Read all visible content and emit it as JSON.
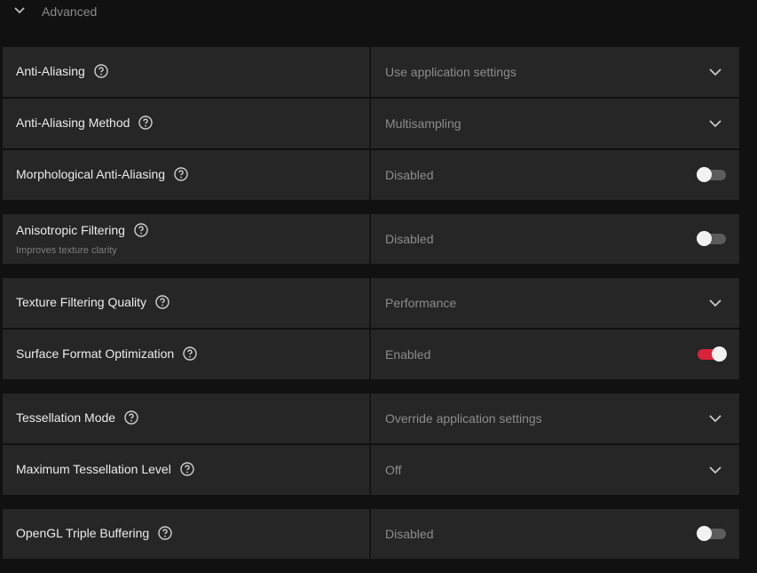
{
  "section": {
    "title": "Advanced"
  },
  "groups": [
    {
      "rows": [
        {
          "label": "Anti-Aliasing",
          "value": "Use application settings",
          "control": "dropdown"
        },
        {
          "label": "Anti-Aliasing Method",
          "value": "Multisampling",
          "control": "dropdown"
        },
        {
          "label": "Morphological Anti-Aliasing",
          "value": "Disabled",
          "control": "toggle",
          "state": "off"
        }
      ]
    },
    {
      "rows": [
        {
          "label": "Anisotropic Filtering",
          "sublabel": "Improves texture clarity",
          "value": "Disabled",
          "control": "toggle",
          "state": "off"
        }
      ]
    },
    {
      "rows": [
        {
          "label": "Texture Filtering Quality",
          "value": "Performance",
          "control": "dropdown"
        },
        {
          "label": "Surface Format Optimization",
          "value": "Enabled",
          "control": "toggle",
          "state": "on"
        }
      ]
    },
    {
      "rows": [
        {
          "label": "Tessellation Mode",
          "value": "Override application settings",
          "control": "dropdown"
        },
        {
          "label": "Maximum Tessellation Level",
          "value": "Off",
          "control": "dropdown"
        }
      ]
    },
    {
      "rows": [
        {
          "label": "OpenGL Triple Buffering",
          "value": "Disabled",
          "control": "toggle",
          "state": "off"
        }
      ]
    }
  ],
  "colors": {
    "background": "#111111",
    "row": "#262626",
    "accent": "#d8233a",
    "toggle_off": "#5c5c5c"
  },
  "icons": {
    "section_toggle": "chevron-down-icon",
    "help": "help-circle-icon",
    "dropdown": "chevron-down-icon"
  }
}
